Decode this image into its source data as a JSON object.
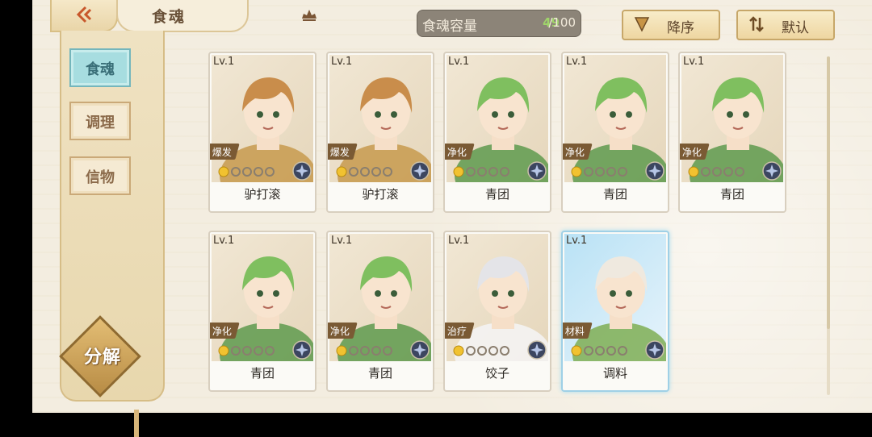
{
  "header": {
    "title": "食魂",
    "capacity_label": "食魂容量",
    "capacity_count": "49",
    "capacity_max": "/100",
    "sort_order_label": "降序",
    "sort_mode_label": "默认"
  },
  "sidebar": {
    "items": [
      {
        "label": "食魂",
        "active": true
      },
      {
        "label": "调理",
        "active": false
      },
      {
        "label": "信物",
        "active": false
      }
    ],
    "decompose_label": "分解"
  },
  "cards": [
    {
      "level": "Lv.1",
      "tag": "爆发",
      "name": "驴打滚",
      "hair": "#c98d4b",
      "outfit": "#c79a4e"
    },
    {
      "level": "Lv.1",
      "tag": "爆发",
      "name": "驴打滚",
      "hair": "#c98d4b",
      "outfit": "#c79a4e"
    },
    {
      "level": "Lv.1",
      "tag": "净化",
      "name": "青团",
      "hair": "#7fbf5f",
      "outfit": "#5e9a4e"
    },
    {
      "level": "Lv.1",
      "tag": "净化",
      "name": "青团",
      "hair": "#7fbf5f",
      "outfit": "#5e9a4e"
    },
    {
      "level": "Lv.1",
      "tag": "净化",
      "name": "青团",
      "hair": "#7fbf5f",
      "outfit": "#5e9a4e"
    },
    {
      "level": "Lv.1",
      "tag": "净化",
      "name": "青团",
      "hair": "#7fbf5f",
      "outfit": "#5e9a4e"
    },
    {
      "level": "Lv.1",
      "tag": "净化",
      "name": "青团",
      "hair": "#7fbf5f",
      "outfit": "#5e9a4e"
    },
    {
      "level": "Lv.1",
      "tag": "治疗",
      "name": "饺子",
      "hair": "#e4e4e8",
      "outfit": "#f4f4f6"
    },
    {
      "level": "Lv.1",
      "tag": "材料",
      "name": "调料",
      "hair": "#efe9df",
      "outfit": "#7fae54"
    }
  ],
  "colors": {
    "accent_green": "#9fd36a",
    "tag_brown": "#7a5a34",
    "active_tab": "#a7dde0"
  }
}
